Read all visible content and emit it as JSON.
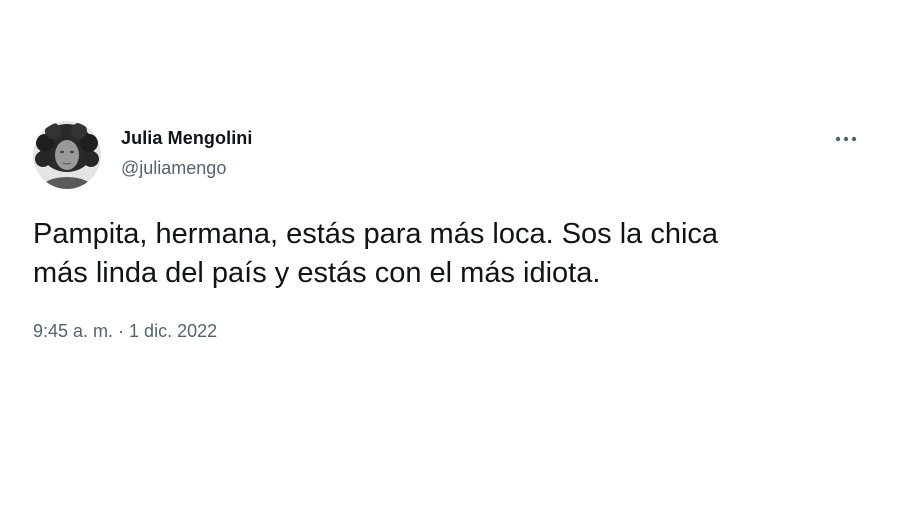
{
  "tweet": {
    "author_name": "Julia Mengolini",
    "author_handle": "@juliamengo",
    "text_lines": [
      "Pampita, hermana, estás para más loca. Sos la chica",
      "más linda del país y estás con el más idiota."
    ],
    "time": "9:45 a. m.",
    "separator": " · ",
    "date": "1 dic. 2022"
  },
  "icons": {
    "more": "more-horizontal-icon",
    "avatar": "user-avatar"
  },
  "colors": {
    "text_primary": "#0f1419",
    "text_secondary": "#536471",
    "background": "#ffffff"
  }
}
